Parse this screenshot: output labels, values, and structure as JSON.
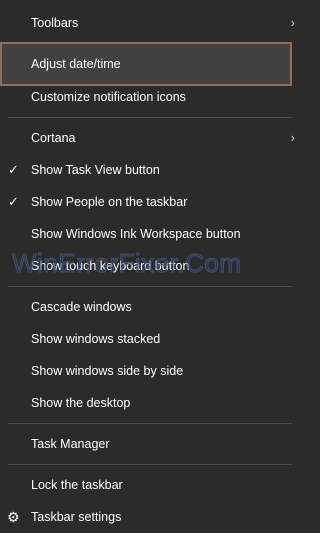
{
  "menu": {
    "items": [
      {
        "label": "Toolbars",
        "has_submenu": true,
        "checked": false
      },
      {
        "label": "Adjust date/time",
        "highlighted": true
      },
      {
        "label": "Customize notification icons"
      },
      {
        "label": "Cortana",
        "has_submenu": true
      },
      {
        "label": "Show Task View button",
        "checked": true
      },
      {
        "label": "Show People on the taskbar",
        "checked": true
      },
      {
        "label": "Show Windows Ink Workspace button"
      },
      {
        "label": "Show touch keyboard button"
      },
      {
        "label": "Cascade windows"
      },
      {
        "label": "Show windows stacked"
      },
      {
        "label": "Show windows side by side"
      },
      {
        "label": "Show the desktop"
      },
      {
        "label": "Task Manager"
      },
      {
        "label": "Lock the taskbar"
      },
      {
        "label": "Taskbar settings",
        "icon": "gear-icon"
      }
    ],
    "submenu_glyph": "›",
    "check_glyph": "✓",
    "gear_glyph": "⚙"
  },
  "watermark": "WinErrorFixer.Com",
  "colors": {
    "background": "#2b2b2b",
    "highlight_bg": "#414141",
    "highlight_border": "#8f6f56",
    "separator": "#4d4d4d",
    "text": "#ffffff"
  }
}
